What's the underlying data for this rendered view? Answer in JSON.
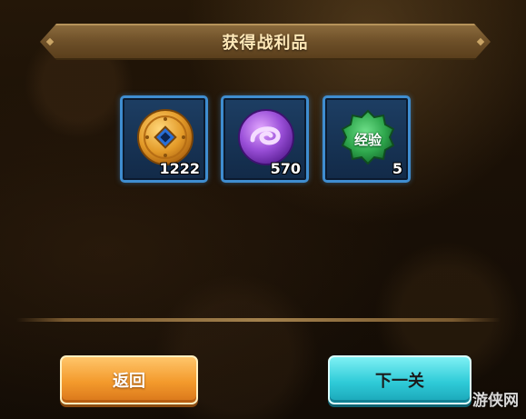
{
  "title": "获得战利品",
  "rewards": [
    {
      "icon": "copper-coin-icon",
      "count": "1222"
    },
    {
      "icon": "purple-orb-icon",
      "count": "570"
    },
    {
      "icon": "experience-badge-icon",
      "label": "经验",
      "count": "5"
    }
  ],
  "buttons": {
    "back": "返回",
    "next": "下一关"
  },
  "watermark": "游侠网",
  "colors": {
    "slot_border": "#3f8dd0",
    "back_button": "#f39a2c",
    "next_button": "#2fcbd8",
    "banner": "#6d4f28"
  }
}
